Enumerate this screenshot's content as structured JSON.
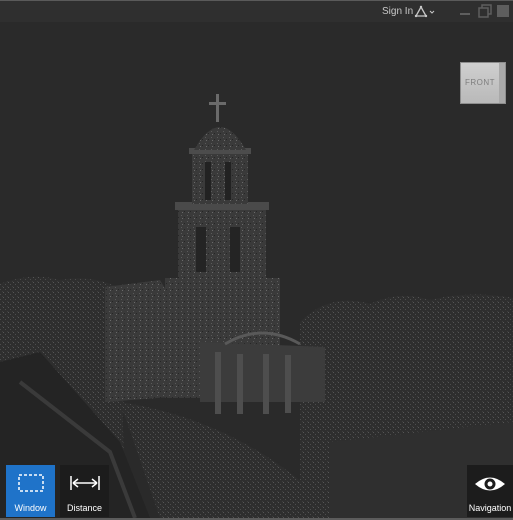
{
  "titlebar": {
    "sign_in": "Sign In",
    "icons": [
      "account-icon",
      "minimize-icon",
      "restore-icon",
      "close-icon"
    ]
  },
  "viewcube": {
    "face_label": "FRONT"
  },
  "toolbar": {
    "window_label": "Window",
    "distance_label": "Distance",
    "navigation_label": "Navigation"
  },
  "colors": {
    "background": "#2a2a2a",
    "accent": "#1f73c9",
    "toolbar_button": "#1c1c1c",
    "text": "#ffffff"
  }
}
